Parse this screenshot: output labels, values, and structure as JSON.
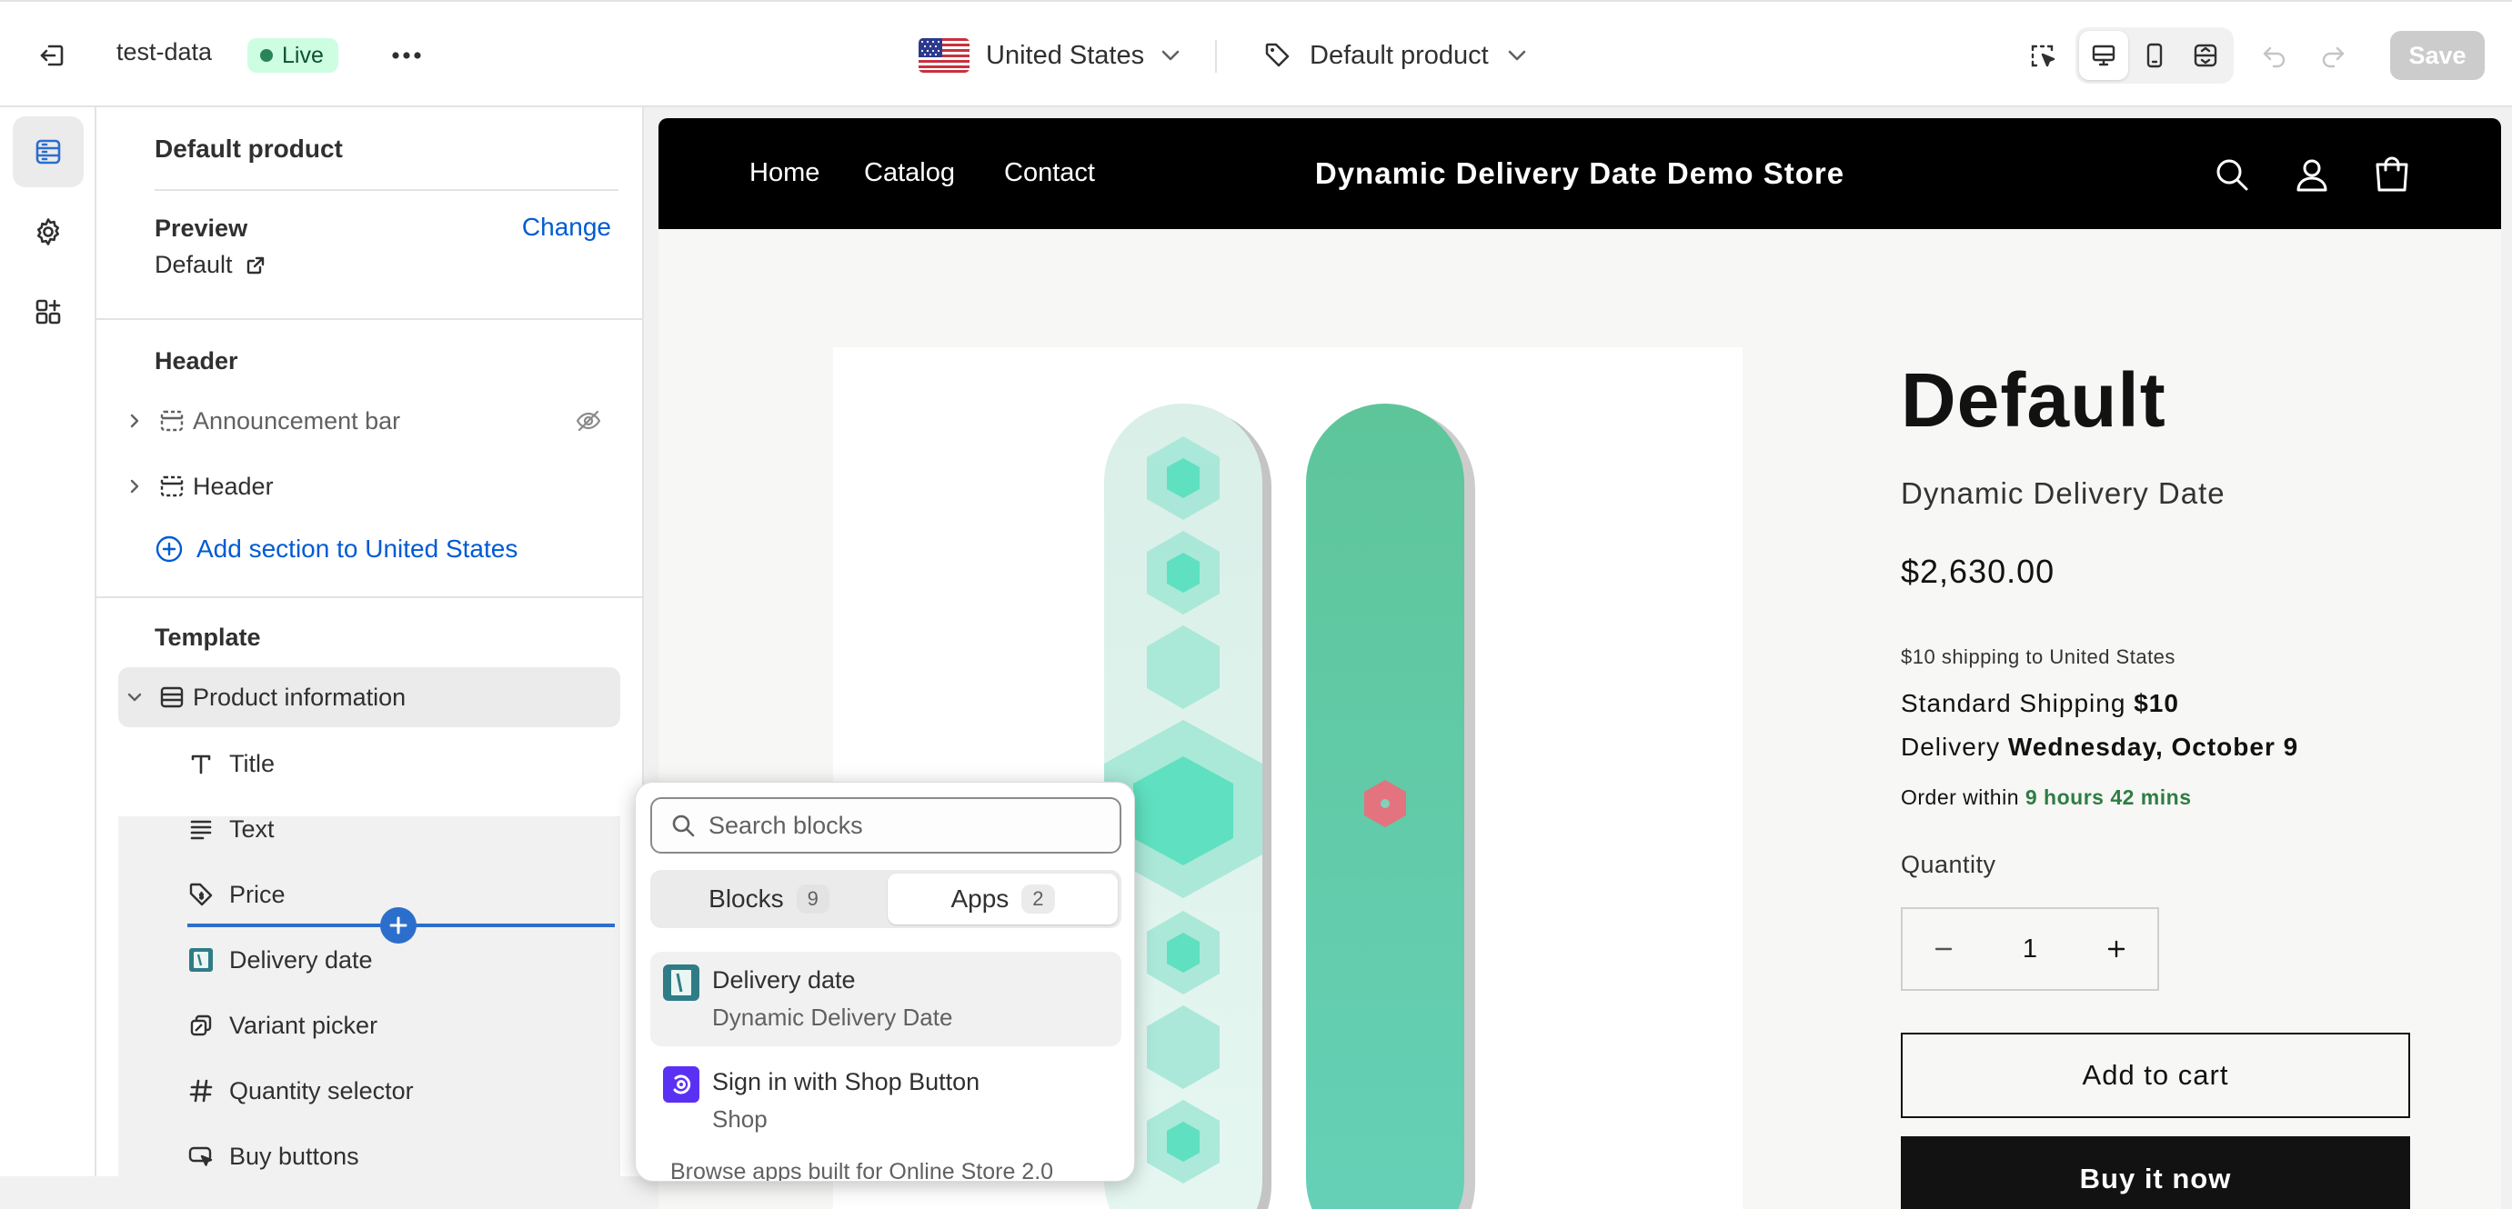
{
  "topbar": {
    "store_name": "test-data",
    "status_badge": "Live",
    "country": "United States",
    "template": "Default product",
    "save_label": "Save"
  },
  "sidebar": {
    "title": "Default product",
    "preview_heading": "Preview",
    "change_label": "Change",
    "preview_value": "Default",
    "header_heading": "Header",
    "header_sections": [
      {
        "label": "Announcement bar",
        "hidden": true
      },
      {
        "label": "Header",
        "hidden": false
      }
    ],
    "add_section_label": "Add section to United States",
    "template_heading": "Template",
    "template_section": "Product information",
    "blocks": [
      {
        "label": "Title",
        "icon": "title-icon"
      },
      {
        "label": "Text",
        "icon": "text-icon"
      },
      {
        "label": "Price",
        "icon": "price-tag-icon"
      },
      {
        "label": "Delivery date",
        "icon": "app-block-icon"
      },
      {
        "label": "Variant picker",
        "icon": "variant-icon"
      },
      {
        "label": "Quantity selector",
        "icon": "hash-icon"
      },
      {
        "label": "Buy buttons",
        "icon": "buy-button-icon"
      }
    ]
  },
  "store": {
    "nav": [
      "Home",
      "Catalog",
      "Contact"
    ],
    "title": "Dynamic Delivery Date Demo Store",
    "product": {
      "title": "Default",
      "subtitle": "Dynamic Delivery Date",
      "price": "$2,630.00",
      "shipping_note": "$10 shipping to United States",
      "standard_label": "Standard Shipping",
      "standard_value": "$10",
      "delivery_label": "Delivery",
      "delivery_value": "Wednesday, October 9",
      "order_prefix": "Order within",
      "order_countdown": "9 hours 42 mins",
      "quantity_label": "Quantity",
      "quantity_value": "1",
      "add_to_cart": "Add to cart",
      "buy_now": "Buy it now"
    }
  },
  "picker": {
    "search_placeholder": "Search blocks",
    "tabs": [
      {
        "label": "Blocks",
        "count": "9",
        "active": false
      },
      {
        "label": "Apps",
        "count": "2",
        "active": true
      }
    ],
    "apps": [
      {
        "name": "Delivery date",
        "vendor": "Dynamic Delivery Date"
      },
      {
        "name": "Sign in with Shop Button",
        "vendor": "Shop"
      }
    ],
    "browse_text": "Browse apps built for Online Store 2.0"
  },
  "colors": {
    "accent": "#005bd3",
    "insert_line": "#2c6ecb",
    "live_badge_bg": "#cdfee1",
    "countdown_green": "#2e7d43",
    "store_header_bg": "#000000",
    "snowboard_left": "#dff5ee",
    "snowboard_right": "#5fcfa5"
  }
}
